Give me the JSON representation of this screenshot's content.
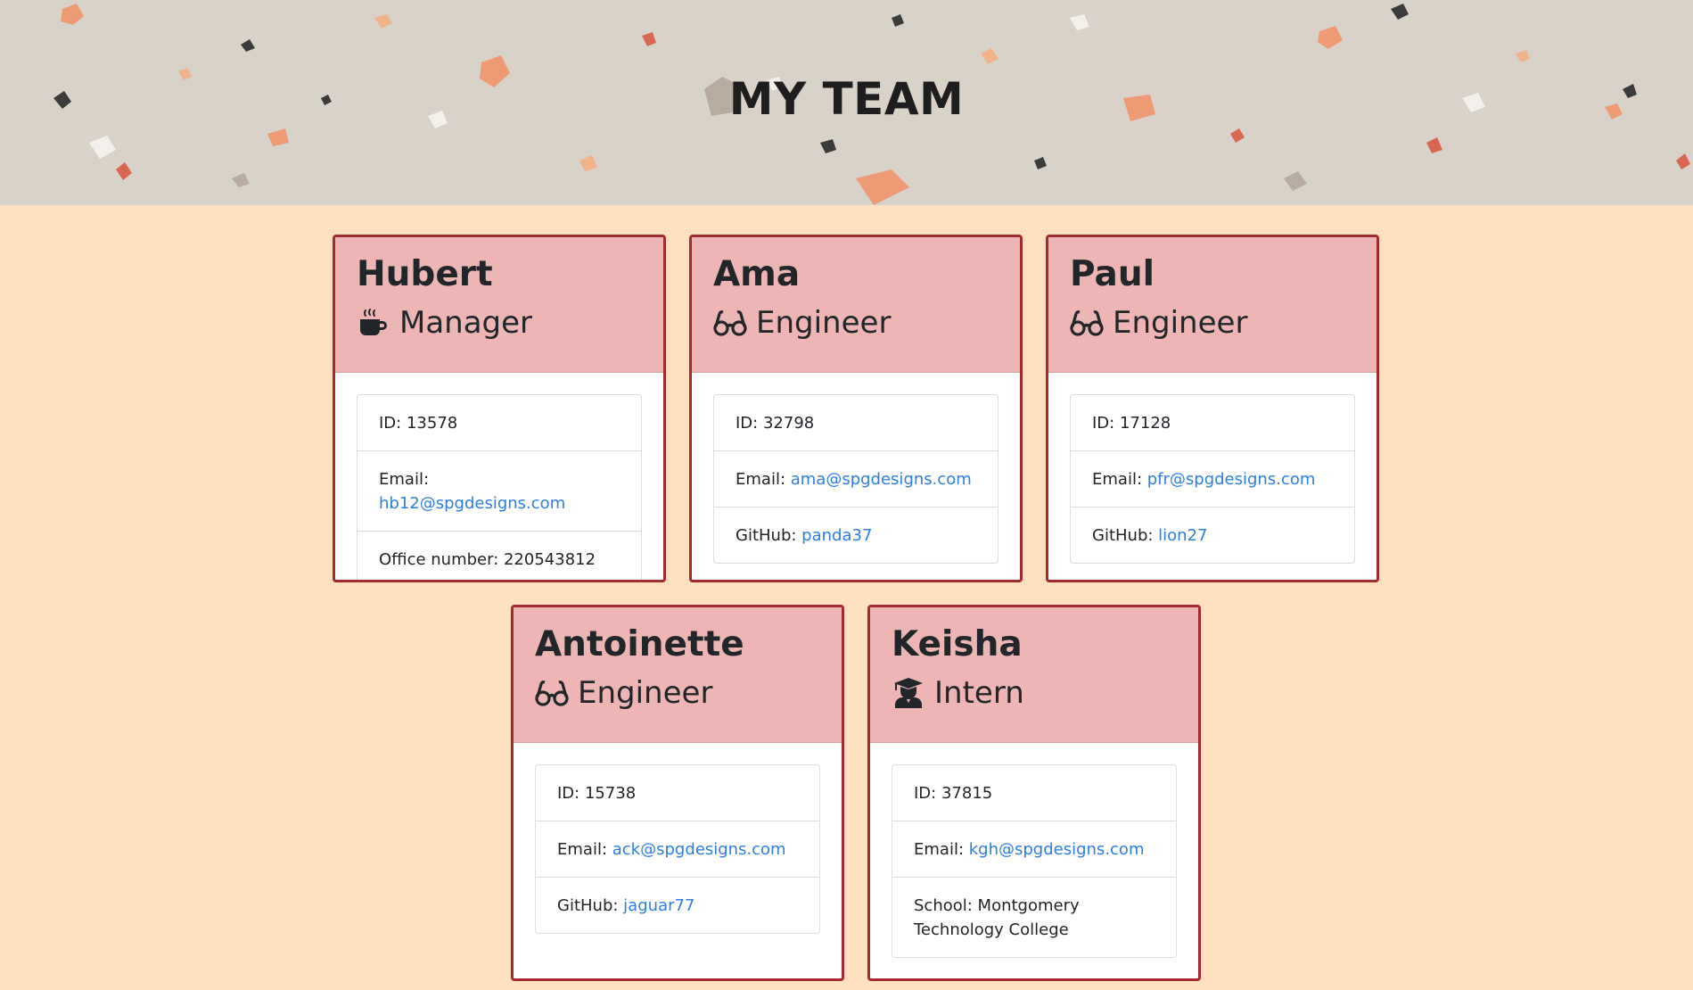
{
  "header": {
    "title": "MY TEAM"
  },
  "colors": {
    "page_bg": "#ffe1bf",
    "card_header_bg": "#edb5b4",
    "card_border": "#a52a2f",
    "link": "#2f7ee0"
  },
  "team": [
    {
      "name": "Hubert",
      "role": "Manager",
      "icon": "coffee-icon",
      "id_label": "ID: ",
      "id": "13578",
      "email_label": "Email: ",
      "email": "hb12@spgdesigns.com",
      "extra_label": "Office number: ",
      "extra": "220543812"
    },
    {
      "name": "Ama",
      "role": "Engineer",
      "icon": "glasses-icon",
      "id_label": "ID: ",
      "id": "32798",
      "email_label": "Email: ",
      "email": "ama@spgdesigns.com",
      "extra_label": "GitHub: ",
      "extra": "panda37"
    },
    {
      "name": "Paul",
      "role": "Engineer",
      "icon": "glasses-icon",
      "id_label": "ID: ",
      "id": "17128",
      "email_label": "Email: ",
      "email": "pfr@spgdesigns.com",
      "extra_label": "GitHub: ",
      "extra": "lion27"
    },
    {
      "name": "Antoinette",
      "role": "Engineer",
      "icon": "glasses-icon",
      "id_label": "ID: ",
      "id": "15738",
      "email_label": "Email: ",
      "email": "ack@spgdesigns.com",
      "extra_label": "GitHub: ",
      "extra": "jaguar77"
    },
    {
      "name": "Keisha",
      "role": "Intern",
      "icon": "graduate-icon",
      "id_label": "ID: ",
      "id": "37815",
      "email_label": "Email: ",
      "email": "kgh@spgdesigns.com",
      "extra_label": "School: ",
      "extra": "Montgomery Technology College"
    }
  ]
}
